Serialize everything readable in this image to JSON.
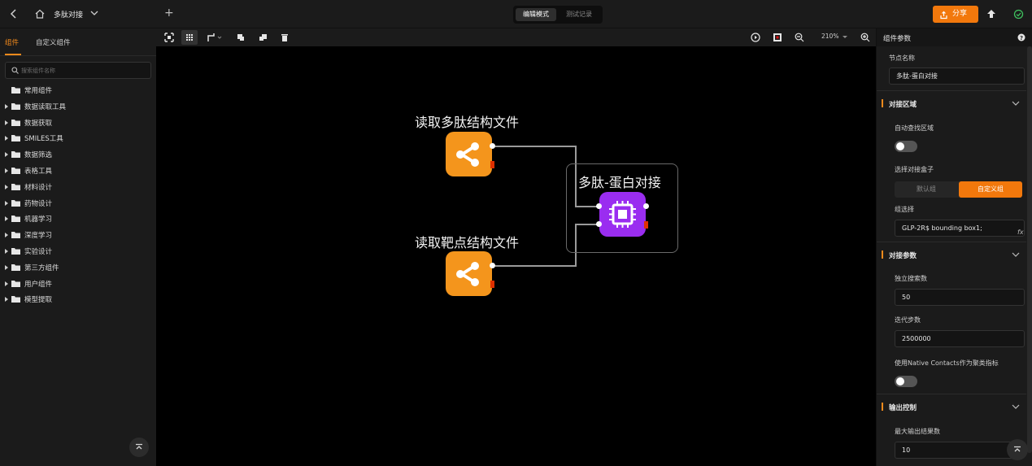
{
  "app": {
    "project_title": "多肽对接",
    "modes": {
      "edit": "编辑模式",
      "test": "测试记录"
    },
    "share_label": "分享"
  },
  "sidebar": {
    "tabs": {
      "components": "组件",
      "custom": "自定义组件"
    },
    "search_placeholder": "搜索组件名称",
    "items": [
      {
        "label": "常用组件",
        "expandable": false
      },
      {
        "label": "数据读取工具",
        "expandable": true
      },
      {
        "label": "数据获取",
        "expandable": true
      },
      {
        "label": "SMILES工具",
        "expandable": true
      },
      {
        "label": "数据筛选",
        "expandable": true
      },
      {
        "label": "表格工具",
        "expandable": true
      },
      {
        "label": "材料设计",
        "expandable": true
      },
      {
        "label": "药物设计",
        "expandable": true
      },
      {
        "label": "机器学习",
        "expandable": true
      },
      {
        "label": "深度学习",
        "expandable": true
      },
      {
        "label": "实验设计",
        "expandable": true
      },
      {
        "label": "第三方组件",
        "expandable": true
      },
      {
        "label": "用户组件",
        "expandable": true
      },
      {
        "label": "模型提取",
        "expandable": true
      }
    ]
  },
  "toolbar": {
    "zoom": "210%"
  },
  "canvas": {
    "nodes": [
      {
        "id": "n1",
        "title": "读取多肽结构文件",
        "color": "#f4951c",
        "icon": "share-nodes-icon"
      },
      {
        "id": "n2",
        "title": "读取靶点结构文件",
        "color": "#f4951c",
        "icon": "share-nodes-icon"
      },
      {
        "id": "n3",
        "title": "多肽-蛋白对接",
        "color": "#9a2df0",
        "icon": "cpu-chip-icon"
      }
    ]
  },
  "panel": {
    "title": "组件参数",
    "node_name_label": "节点名称",
    "node_name_value": "多肽-蛋白对接",
    "section_dock_area": "对接区域",
    "auto_find_label": "自动查找区域",
    "select_box_label": "选择对接盒子",
    "box_options": {
      "default": "默认组",
      "custom": "自定义组"
    },
    "group_select_label": "组选择",
    "group_select_value": "GLP-2R$ bounding box1;",
    "fx_label": "fx",
    "section_dock_params": "对接参数",
    "independent_search_label": "独立搜索数",
    "independent_search_value": "50",
    "iteration_steps_label": "迭代步数",
    "iteration_steps_value": "2500000",
    "native_contacts_label": "使用Native Contacts作为聚类指标",
    "section_output": "输出控制",
    "max_output_label": "最大输出结果数",
    "max_output_value": "10"
  },
  "colors": {
    "accent": "#f2780c",
    "node_orange": "#f4951c",
    "node_purple": "#9a2df0",
    "status_ok": "#3fc35f"
  }
}
